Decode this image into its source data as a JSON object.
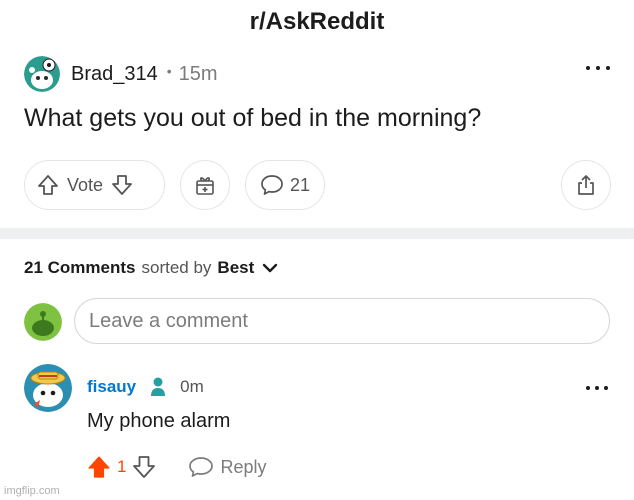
{
  "header": {
    "title": "r/AskReddit"
  },
  "post": {
    "author": "Brad_314",
    "separator": "•",
    "time": "15m",
    "title": "What gets you out of bed in the morning?",
    "vote_label": "Vote",
    "comment_count": "21",
    "icons": [
      "upvote-icon",
      "downvote-icon",
      "award-icon",
      "comment-icon",
      "share-icon",
      "more-options-icon"
    ]
  },
  "comments_section": {
    "count_label": "21 Comments",
    "sorted_by_label": "sorted by",
    "sort_value": "Best",
    "compose_placeholder": "Leave a comment"
  },
  "comment": {
    "author": "fisauy",
    "time": "0m",
    "body": "My phone alarm",
    "score": "1",
    "reply_label": "Reply"
  },
  "watermark": "imgflip.com",
  "colors": {
    "upvote": "#ff4500",
    "username": "#0079d3",
    "op_badge": "#24a0a0",
    "divider": "#edeff1"
  }
}
